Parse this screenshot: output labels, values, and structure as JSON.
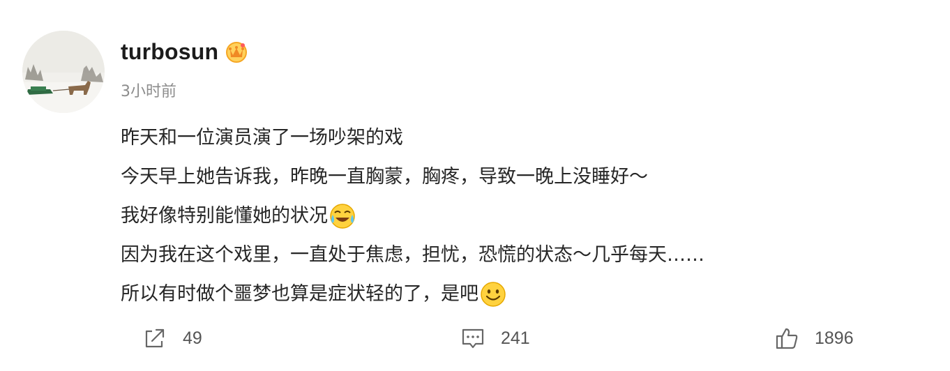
{
  "post": {
    "username": "turbosun",
    "badge_icon": "vip-crown-icon",
    "timestamp": "3小时前",
    "avatar_icon": "snowy-landscape-avatar",
    "lines": [
      "昨天和一位演员演了一场吵架的戏",
      "今天早上她告诉我，昨晚一直胸蒙，胸疼，导致一晚上没睡好～",
      "我好像特别能懂她的状况",
      "因为我在这个戏里，一直处于焦虑，担忧，恐慌的状态～几乎每天……",
      "所以有时做个噩梦也算是症状轻的了，是吧"
    ],
    "emojis": {
      "line3": "laugh-cry-emoji",
      "line5": "smile-emoji"
    }
  },
  "actions": {
    "share": {
      "icon": "share-icon",
      "count": "49"
    },
    "comment": {
      "icon": "comment-icon",
      "count": "241"
    },
    "like": {
      "icon": "thumbs-up-icon",
      "count": "1896"
    }
  },
  "colors": {
    "text": "#262626",
    "muted": "#8c8c8c",
    "badge": "#f5a623"
  }
}
